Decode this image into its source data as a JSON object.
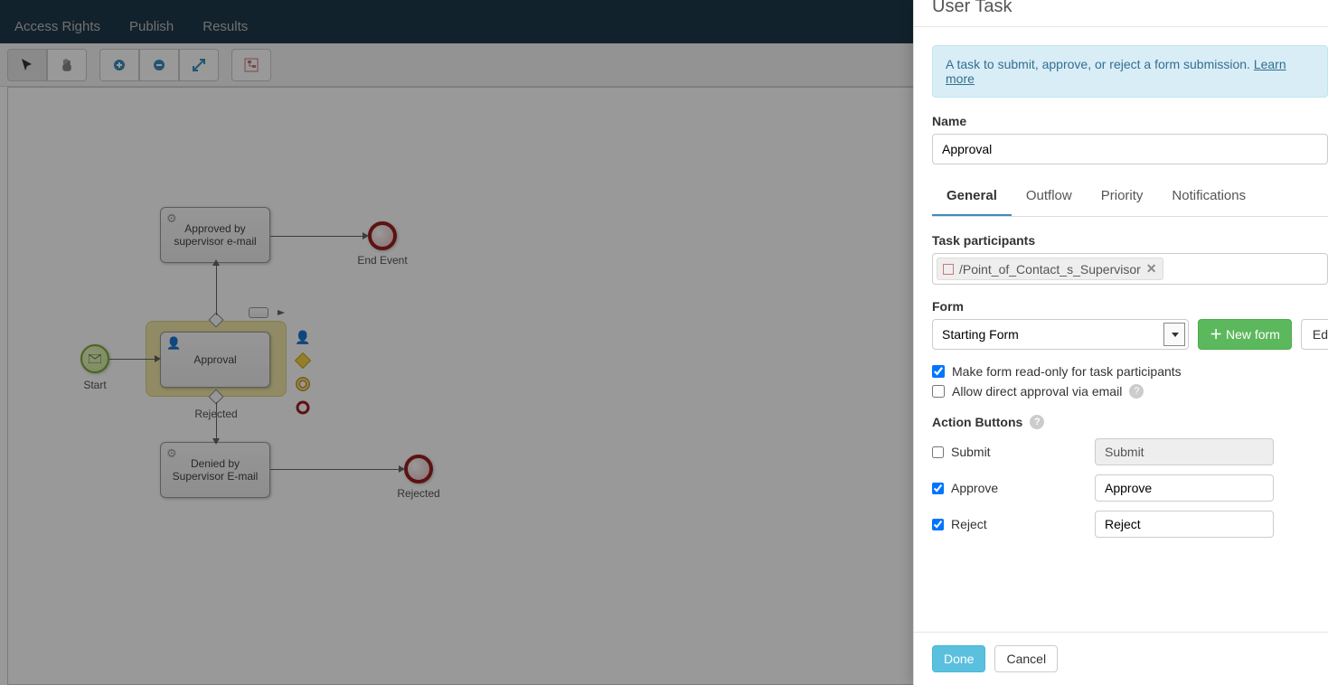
{
  "nav": {
    "items": [
      "Access Rights",
      "Publish",
      "Results"
    ]
  },
  "toolbar": {
    "tools": [
      {
        "name": "pointer-tool",
        "interact": true
      },
      {
        "name": "pan-tool",
        "interact": true
      },
      {
        "name": "zoom-in-tool",
        "interact": true
      },
      {
        "name": "zoom-out-tool",
        "interact": true
      },
      {
        "name": "fit-screen-tool",
        "interact": true
      },
      {
        "name": "minimap-tool",
        "interact": true
      }
    ]
  },
  "workflow": {
    "start": {
      "label": "Start"
    },
    "approval": {
      "label": "Approval"
    },
    "approved_email": {
      "label": "Approved by supervisor e-mail"
    },
    "denied_email": {
      "label": "Denied by Supervisor E-mail"
    },
    "end_top": {
      "label": "End Event"
    },
    "end_bottom": {
      "label": "Rejected"
    },
    "branch_label": "Rejected"
  },
  "panel": {
    "title": "User Task",
    "info_text": "A task to submit, approve, or reject a form submission. ",
    "info_link": "Learn more",
    "name_label": "Name",
    "name_value": "Approval",
    "tabs": [
      "General",
      "Outflow",
      "Priority",
      "Notifications"
    ],
    "active_tab": 0,
    "participants": {
      "label": "Task participants",
      "token": "/Point_of_Contact_s_Supervisor"
    },
    "form": {
      "label": "Form",
      "value": "Starting Form",
      "new_btn": "New form",
      "edit_btn": "Edit"
    },
    "checks": {
      "readonly": {
        "label": "Make form read-only for task participants",
        "checked": true
      },
      "direct_approval": {
        "label": "Allow direct approval via email",
        "checked": false
      }
    },
    "action_buttons": {
      "heading": "Action Buttons",
      "rows": [
        {
          "key": "submit",
          "label": "Submit",
          "checked": false,
          "value": "Submit",
          "disabled": true
        },
        {
          "key": "approve",
          "label": "Approve",
          "checked": true,
          "value": "Approve",
          "disabled": false
        },
        {
          "key": "reject",
          "label": "Reject",
          "checked": true,
          "value": "Reject",
          "disabled": false
        }
      ]
    },
    "footer": {
      "done": "Done",
      "cancel": "Cancel"
    }
  }
}
